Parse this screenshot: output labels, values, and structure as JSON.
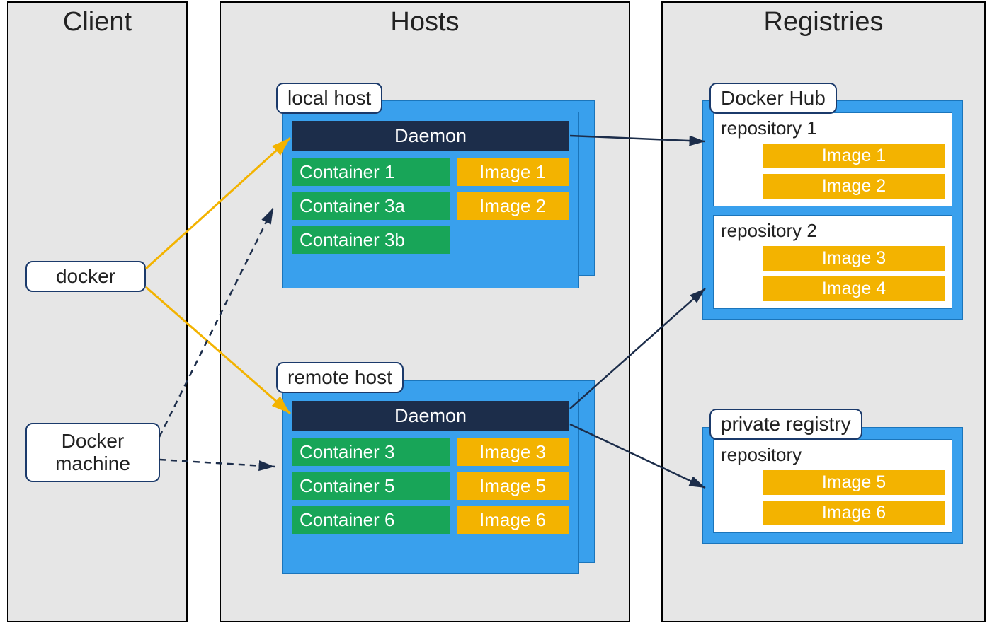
{
  "columns": {
    "client": {
      "title": "Client"
    },
    "hosts": {
      "title": "Hosts"
    },
    "registries": {
      "title": "Registries"
    }
  },
  "client": {
    "docker": "docker",
    "docker_machine_line1": "Docker",
    "docker_machine_line2": "machine"
  },
  "hosts": {
    "local": {
      "label": "local host",
      "daemon": "Daemon",
      "rows": [
        {
          "container": "Container  1",
          "image": "Image 1"
        },
        {
          "container": "Container 3a",
          "image": "Image 2"
        },
        {
          "container": "Container 3b",
          "image": null
        }
      ]
    },
    "remote": {
      "label": "remote host",
      "daemon": "Daemon",
      "rows": [
        {
          "container": "Container 3",
          "image": "Image 3"
        },
        {
          "container": "Container 5",
          "image": "Image 5"
        },
        {
          "container": "Container 6",
          "image": "Image 6"
        }
      ]
    }
  },
  "registries": {
    "dockerhub": {
      "label": "Docker Hub",
      "repos": [
        {
          "title": "repository 1",
          "images": [
            "Image 1",
            "Image 2"
          ]
        },
        {
          "title": "repository 2",
          "images": [
            "Image 3",
            "Image 4"
          ]
        }
      ]
    },
    "private": {
      "label": "private registry",
      "repos": [
        {
          "title": "repository",
          "images": [
            "Image 5",
            "Image 6"
          ]
        }
      ]
    }
  },
  "arrows": [
    {
      "from": "docker",
      "to": "local-daemon",
      "style": "solid-orange"
    },
    {
      "from": "docker",
      "to": "remote-daemon",
      "style": "solid-orange"
    },
    {
      "from": "docker-machine",
      "to": "local-daemon",
      "style": "dashed-navy"
    },
    {
      "from": "docker-machine",
      "to": "remote-daemon",
      "style": "dashed-navy"
    },
    {
      "from": "local-daemon",
      "to": "dockerhub-repo1",
      "style": "solid-navy"
    },
    {
      "from": "remote-daemon",
      "to": "dockerhub-repo2",
      "style": "solid-navy"
    },
    {
      "from": "remote-daemon",
      "to": "private-repo",
      "style": "solid-navy"
    }
  ]
}
